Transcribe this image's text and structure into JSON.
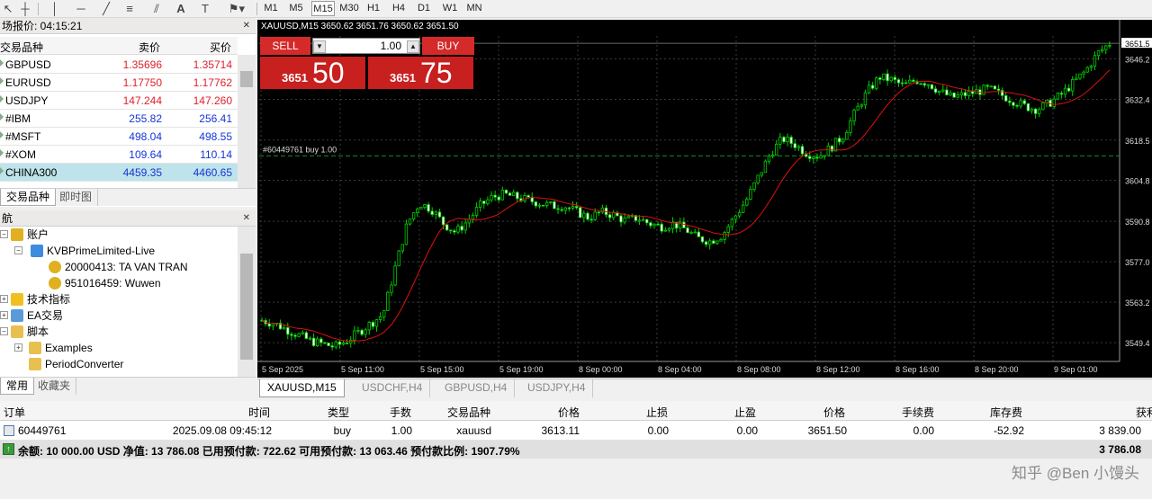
{
  "toolbar": {
    "timeframes": [
      "M1",
      "M5",
      "M15",
      "M30",
      "H1",
      "H4",
      "D1",
      "W1",
      "MN"
    ],
    "active_timeframe": "M15"
  },
  "market_watch": {
    "title": "场报价: 04:15:21",
    "columns": [
      "交易品种",
      "卖价",
      "买价"
    ],
    "rows": [
      {
        "symbol": "GBPUSD",
        "bid": "1.35696",
        "ask": "1.35714",
        "color": "#e0202b"
      },
      {
        "symbol": "EURUSD",
        "bid": "1.17750",
        "ask": "1.17762",
        "color": "#e0202b"
      },
      {
        "symbol": "USDJPY",
        "bid": "147.244",
        "ask": "147.260",
        "color": "#e0202b"
      },
      {
        "symbol": "#IBM",
        "bid": "255.82",
        "ask": "256.41",
        "color": "#1435d6"
      },
      {
        "symbol": "#MSFT",
        "bid": "498.04",
        "ask": "498.55",
        "color": "#1435d6"
      },
      {
        "symbol": "#XOM",
        "bid": "109.64",
        "ask": "110.14",
        "color": "#1435d6"
      },
      {
        "symbol": "CHINA300",
        "bid": "4459.35",
        "ask": "4460.65",
        "color": "#1435d6",
        "selected": true
      }
    ],
    "tabs": [
      "交易品种",
      "即时图"
    ]
  },
  "navigator": {
    "title": "航",
    "items": [
      {
        "label": "账户"
      },
      {
        "label": "KVBPrimeLimited-Live"
      },
      {
        "label": "20000413: TA VAN TRAN"
      },
      {
        "label": "951016459: Wuwen"
      },
      {
        "label": "技术指标"
      },
      {
        "label": "EA交易"
      },
      {
        "label": "脚本"
      },
      {
        "label": "Examples"
      },
      {
        "label": "PeriodConverter"
      }
    ],
    "tabs": [
      "常用",
      "收藏夹"
    ]
  },
  "chart": {
    "header": "XAUUSD,M15  3650.62 3651.76 3650.62 3651.50",
    "sell_label": "SELL",
    "buy_label": "BUY",
    "lot": "1.00",
    "sell_price_small": "3651",
    "sell_price_big": "50",
    "buy_price_small": "3651",
    "buy_price_big": "75",
    "order_label": "#60449761 buy 1.00",
    "current_price": "3651.5",
    "tabs": [
      "XAUUSD,M15",
      "USDCHF,H4",
      "GBPUSD,H4",
      "USDJPY,H4"
    ],
    "active_tab": "XAUUSD,M15"
  },
  "chart_data": {
    "type": "candlestick",
    "ylim": [
      3543,
      3654
    ],
    "yticks": [
      "3651.5",
      "3646.2",
      "3632.4",
      "3618.5",
      "3604.8",
      "3590.8",
      "3577.0",
      "3563.2",
      "3549.4"
    ],
    "ytick_values": [
      3651.5,
      3646.2,
      3632.4,
      3618.5,
      3604.8,
      3590.8,
      3577.0,
      3563.2,
      3549.4
    ],
    "xticks": [
      "5 Sep 2025",
      "5 Sep 11:00",
      "5 Sep 15:00",
      "5 Sep 19:00",
      "8 Sep 00:00",
      "8 Sep 04:00",
      "8 Sep 08:00",
      "8 Sep 12:00",
      "8 Sep 16:00",
      "8 Sep 20:00",
      "9 Sep 01:00"
    ],
    "order_line": 3613.1,
    "close_path": [
      3557,
      3556,
      3554,
      3552,
      3550,
      3549,
      3548,
      3550,
      3553,
      3556,
      3559,
      3575,
      3590,
      3597,
      3595,
      3590,
      3587,
      3591,
      3596,
      3599,
      3600,
      3599,
      3598,
      3597,
      3596,
      3596,
      3594,
      3592,
      3594,
      3593,
      3591,
      3592,
      3590,
      3589,
      3590,
      3588,
      3585,
      3584,
      3586,
      3592,
      3598,
      3606,
      3614,
      3619,
      3617,
      3614,
      3613,
      3616,
      3620,
      3628,
      3635,
      3640,
      3639,
      3637,
      3639,
      3638,
      3635,
      3633,
      3634,
      3635,
      3636,
      3634,
      3632,
      3630,
      3629,
      3631,
      3634,
      3638,
      3642,
      3648,
      3651.5
    ]
  },
  "terminal": {
    "columns": [
      "订单",
      "时间",
      "类型",
      "手数",
      "交易品种",
      "价格",
      "止损",
      "止盈",
      "价格",
      "手续费",
      "库存费",
      "获利"
    ],
    "row": {
      "order": "60449761",
      "time": "2025.09.08 09:45:12",
      "type": "buy",
      "lots": "1.00",
      "symbol": "xauusd",
      "price_open": "3613.11",
      "sl": "0.00",
      "tp": "0.00",
      "price_current": "3651.50",
      "commission": "0.00",
      "swap": "-52.92",
      "profit": "3 839.00"
    },
    "summary": "余额: 10 000.00 USD  净值: 13 786.08  已用预付款: 722.62  可用预付款: 13 063.46  预付款比例: 1907.79%",
    "summary_total": "3 786.08"
  },
  "watermark": "知乎 @Ben 小馒头"
}
